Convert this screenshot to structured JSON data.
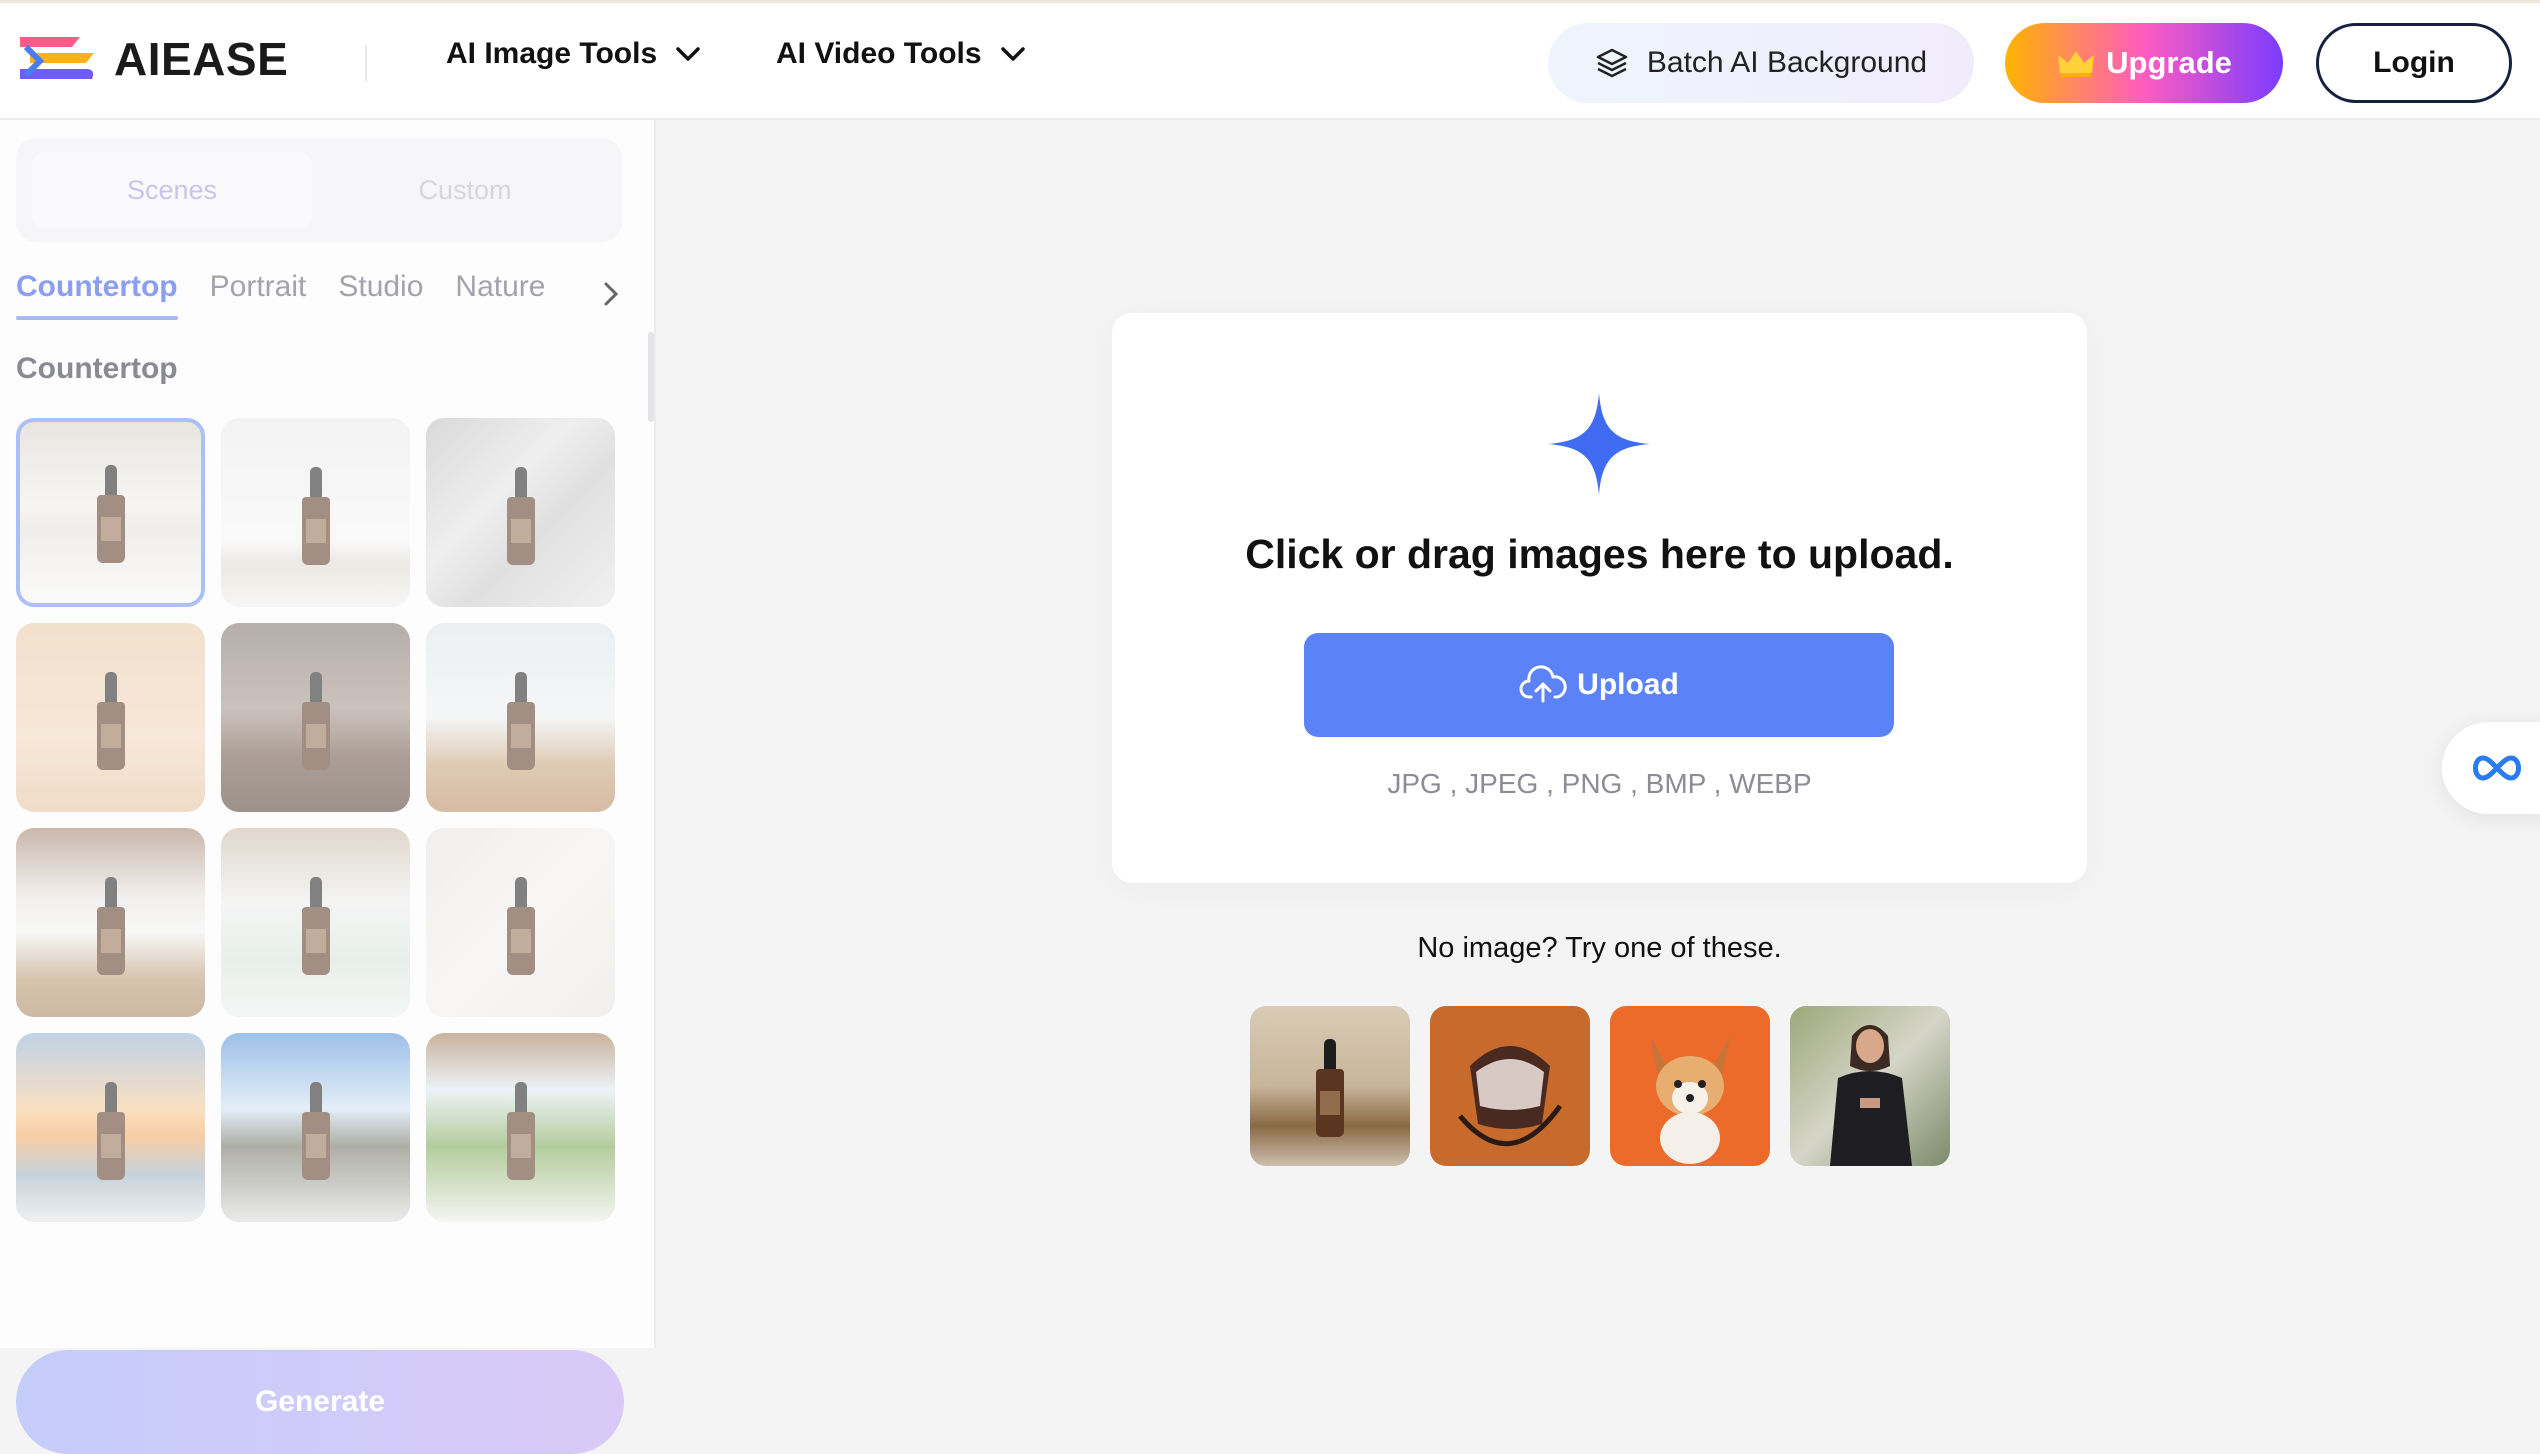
{
  "header": {
    "logo_text": "AIEASE",
    "nav": [
      {
        "label": "AI Image Tools",
        "icon": "chevron-down-icon"
      },
      {
        "label": "AI Video Tools",
        "icon": "chevron-down-icon"
      }
    ],
    "batch_button": "Batch AI Background",
    "upgrade_button": "Upgrade",
    "login_button": "Login"
  },
  "sidebar": {
    "segments": [
      "Scenes",
      "Custom"
    ],
    "active_segment": "Scenes",
    "categories": [
      "Countertop",
      "Portrait",
      "Studio",
      "Nature"
    ],
    "active_category": "Countertop",
    "section_title": "Countertop",
    "generate_button": "Generate",
    "thumbnails": [
      {
        "scene": "kitchen countertop",
        "selected": true
      },
      {
        "scene": "white pedestal"
      },
      {
        "scene": "marble shadow"
      },
      {
        "scene": "wood wall"
      },
      {
        "scene": "brown wood table"
      },
      {
        "scene": "flowers window"
      },
      {
        "scene": "pillow flowers rattan"
      },
      {
        "scene": "white roses marble"
      },
      {
        "scene": "white stone"
      },
      {
        "scene": "sunset sea"
      },
      {
        "scene": "terrace sky"
      },
      {
        "scene": "garden pergola"
      }
    ]
  },
  "upload": {
    "title": "Click or drag images here to upload.",
    "button": "Upload",
    "formats": "JPG , JPEG , PNG , BMP , WEBP",
    "try_text": "No image? Try one of these.",
    "samples": [
      "serum bottle",
      "leather bag",
      "corgi puppy",
      "woman in jacket"
    ]
  },
  "colors": {
    "accent": "#5b82f6",
    "active_tab": "#8b9ef0"
  }
}
